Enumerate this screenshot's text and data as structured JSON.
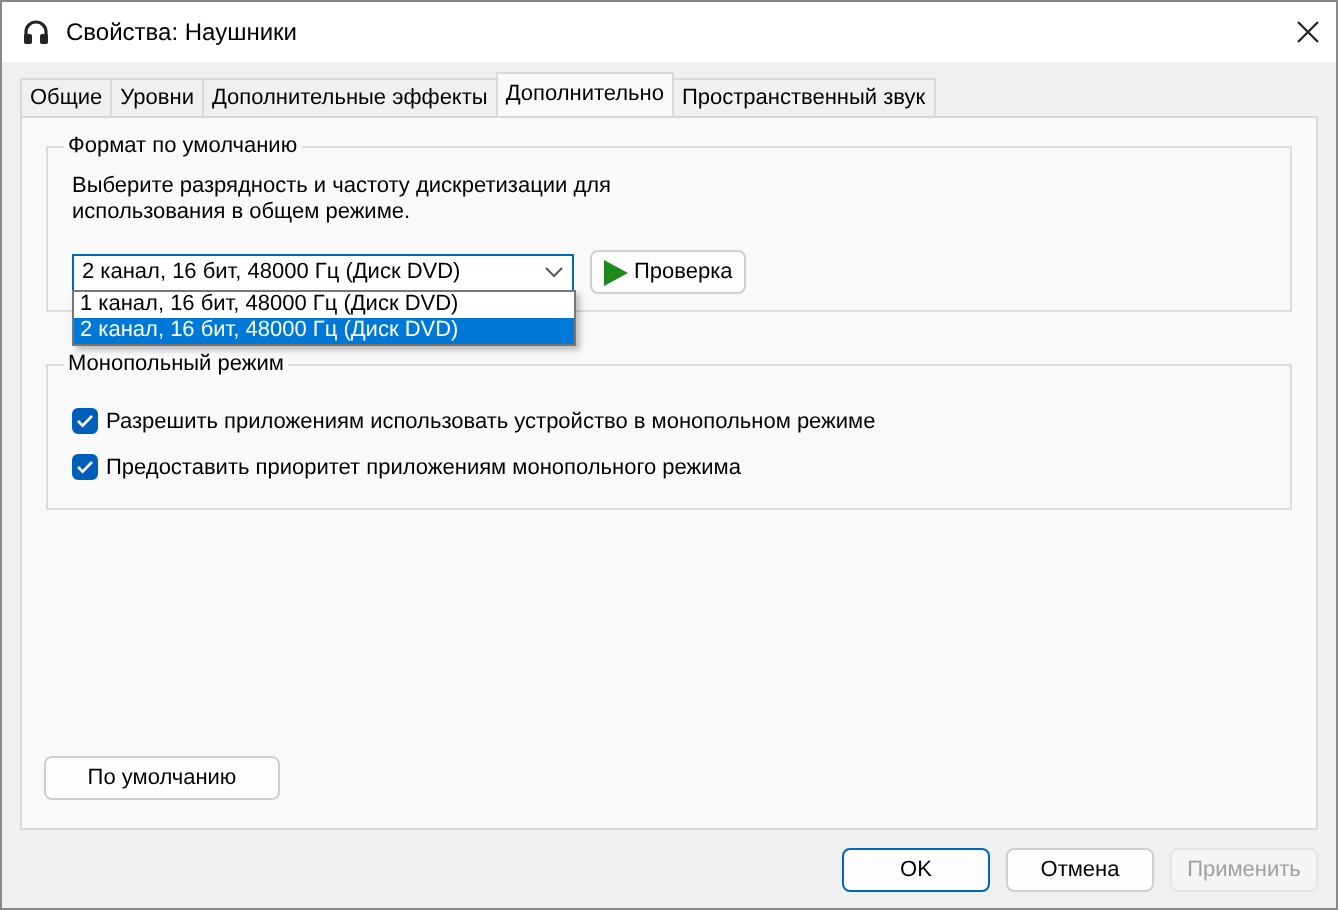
{
  "window": {
    "title": "Свойства: Наушники"
  },
  "tabs": [
    {
      "label": "Общие",
      "selected": false
    },
    {
      "label": "Уровни",
      "selected": false
    },
    {
      "label": "Дополнительные эффекты",
      "selected": false
    },
    {
      "label": "Дополнительно",
      "selected": true
    },
    {
      "label": "Пространственный звук",
      "selected": false
    }
  ],
  "default_format": {
    "title": "Формат по умолчанию",
    "description": "Выберите разрядность и частоту дискретизации для использования в общем режиме.",
    "combo": {
      "value": "2 канал, 16 бит, 48000 Гц (Диск DVD)",
      "expanded": true
    },
    "test_button": "Проверка",
    "options": [
      {
        "label": "1 канал, 16 бит, 48000 Гц (Диск DVD)",
        "selected": false
      },
      {
        "label": "2 канал, 16 бит, 48000 Гц (Диск DVD)",
        "selected": true
      }
    ]
  },
  "exclusive_mode": {
    "title": "Монопольный режим",
    "options": [
      {
        "label": "Разрешить приложениям использовать устройство в монопольном режиме",
        "checked": true
      },
      {
        "label": "Предоставить приоритет приложениям монопольного режима",
        "checked": true
      }
    ]
  },
  "restore_button": "По умолчанию",
  "buttons": [
    {
      "label": "OK",
      "primary": true,
      "disabled": false
    },
    {
      "label": "Отмена",
      "primary": false,
      "disabled": false
    },
    {
      "label": "Применить",
      "primary": false,
      "disabled": true
    }
  ]
}
